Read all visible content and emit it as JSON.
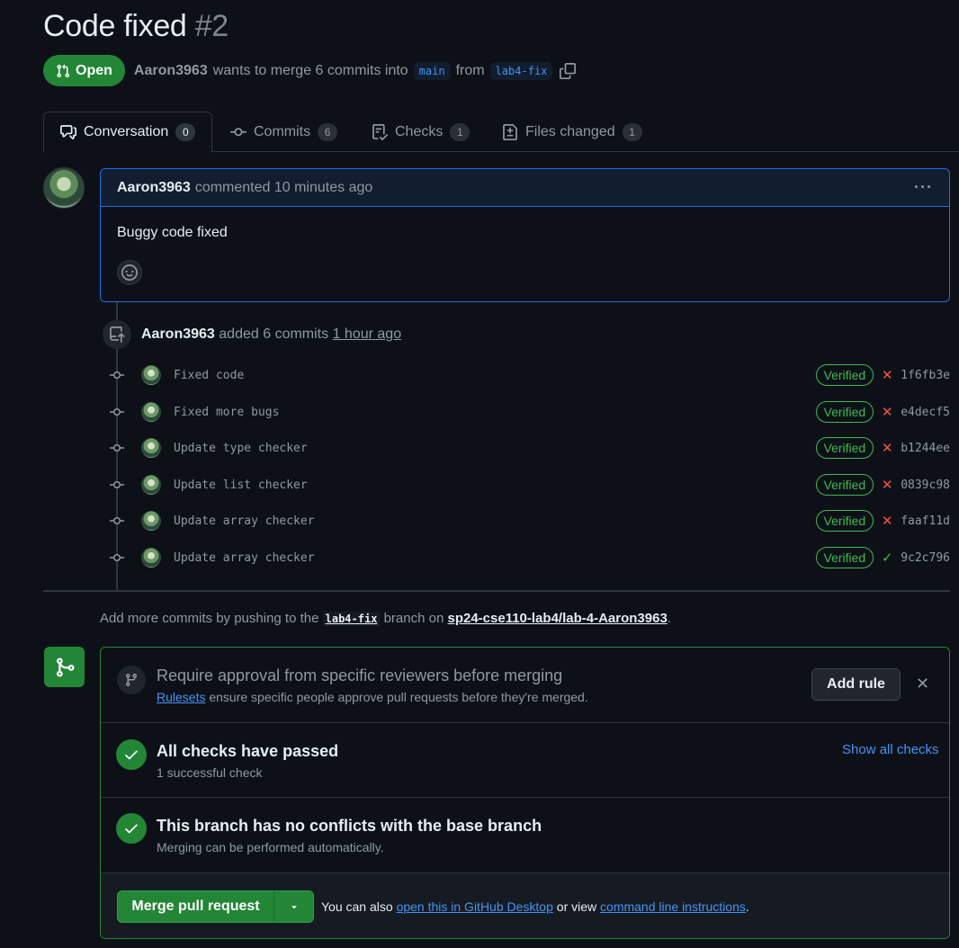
{
  "pr": {
    "title": "Code fixed",
    "number": "#2",
    "state": "Open",
    "author": "Aaron3963",
    "meta_text": "wants to merge 6 commits into",
    "base_branch": "main",
    "from_text": "from",
    "head_branch": "lab4-fix"
  },
  "tabs": [
    {
      "label": "Conversation",
      "count": "0",
      "icon": "comment-discussion-icon"
    },
    {
      "label": "Commits",
      "count": "6",
      "icon": "git-commit-icon"
    },
    {
      "label": "Checks",
      "count": "1",
      "icon": "checklist-icon"
    },
    {
      "label": "Files changed",
      "count": "1",
      "icon": "file-diff-icon"
    }
  ],
  "comment": {
    "author": "Aaron3963",
    "action": "commented 10 minutes ago",
    "body": "Buggy code fixed"
  },
  "commits_event": {
    "author": "Aaron3963",
    "text": "added 6 commits",
    "time": "1 hour ago"
  },
  "commits": [
    {
      "message": "Fixed code",
      "verified": "Verified",
      "status": "fail",
      "sha": "1f6fb3e"
    },
    {
      "message": "Fixed more bugs",
      "verified": "Verified",
      "status": "fail",
      "sha": "e4decf5"
    },
    {
      "message": "Update type checker",
      "verified": "Verified",
      "status": "fail",
      "sha": "b1244ee"
    },
    {
      "message": "Update list checker",
      "verified": "Verified",
      "status": "fail",
      "sha": "0839c98"
    },
    {
      "message": "Update array checker",
      "verified": "Verified",
      "status": "fail",
      "sha": "faaf11d"
    },
    {
      "message": "Update array checker",
      "verified": "Verified",
      "status": "success",
      "sha": "9c2c796"
    }
  ],
  "push_note": {
    "prefix": "Add more commits by pushing to the",
    "branch": "lab4-fix",
    "middle": "branch on",
    "repo": "sp24-cse110-lab4/lab-4-Aaron3963",
    "suffix": "."
  },
  "mergebox": {
    "ruleset_title": "Require approval from specific reviewers before merging",
    "ruleset_link": "Rulesets",
    "ruleset_sub": "ensure specific people approve pull requests before they're merged.",
    "add_rule": "Add rule",
    "checks_title": "All checks have passed",
    "checks_sub": "1 successful check",
    "show_checks": "Show all checks",
    "conflicts_title": "This branch has no conflicts with the base branch",
    "conflicts_sub": "Merging can be performed automatically.",
    "merge_label": "Merge pull request",
    "note_prefix": "You can also",
    "desktop_link": "open this in GitHub Desktop",
    "note_mid": "or view",
    "cli_link": "command line instructions",
    "note_suffix": "."
  },
  "colors": {
    "background": "#0d1117",
    "success": "#238636",
    "verified": "#3fb950",
    "fail": "#f85149",
    "link": "#4493f8"
  }
}
